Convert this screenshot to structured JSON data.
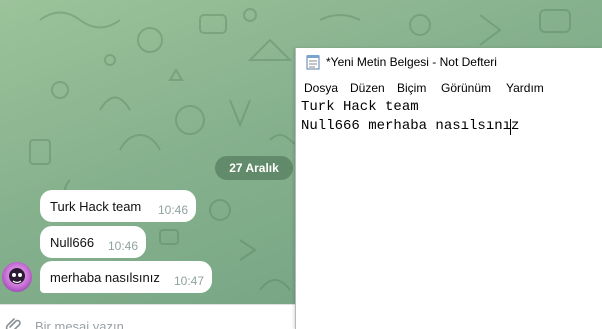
{
  "telegram": {
    "date_divider": "27 Aralık",
    "messages": [
      {
        "text": "Turk Hack team",
        "time": "10:46"
      },
      {
        "text": "Null666",
        "time": "10:46"
      },
      {
        "text": "merhaba nasılsınız",
        "time": "10:47"
      }
    ],
    "input_placeholder": "Bir mesaj yazın"
  },
  "notepad": {
    "title": "*Yeni Metin Belgesi - Not Defteri",
    "menu": [
      "Dosya",
      "Düzen",
      "Biçim",
      "Görünüm",
      "Yardım"
    ],
    "lines": [
      "Turk Hack team",
      "Null666 merhaba nasılsınız"
    ]
  }
}
